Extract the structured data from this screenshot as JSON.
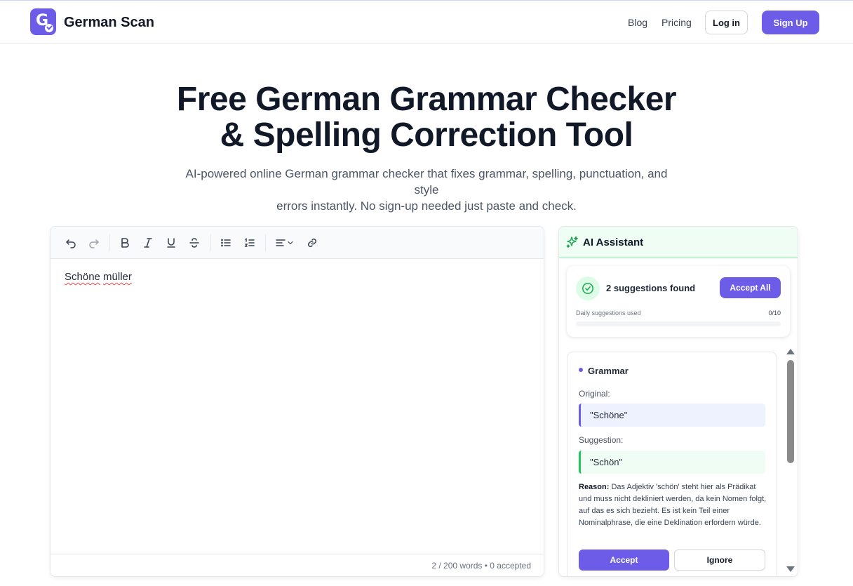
{
  "brand": {
    "name": "German Scan"
  },
  "nav": {
    "blog": "Blog",
    "pricing": "Pricing",
    "login": "Log in",
    "signup": "Sign Up"
  },
  "hero": {
    "title_line1": "Free German Grammar Checker",
    "title_line2": "& Spelling Correction Tool",
    "subtitle_line1": "AI-powered online German grammar checker that fixes grammar, spelling, punctuation, and style",
    "subtitle_line2": "errors instantly. No sign-up needed just paste and check."
  },
  "editor": {
    "toolbar": [
      "undo-icon",
      "redo-icon",
      "bold-icon",
      "italic-icon",
      "underline-icon",
      "strikethrough-icon",
      "bullet-list-icon",
      "numbered-list-icon",
      "align-icon",
      "link-icon"
    ],
    "word1": "Schöne",
    "word2": "müller",
    "footer": "2 / 200 words • 0 accepted"
  },
  "assistant": {
    "title": "AI Assistant",
    "summary": "2 suggestions found",
    "accept_all": "Accept All",
    "usage_label": "Daily suggestions used",
    "usage_count": "0/10",
    "usage_used": 0,
    "usage_limit": 10,
    "card": {
      "category": "Grammar",
      "original_label": "Original:",
      "original": "\"Schöne\"",
      "suggestion_label": "Suggestion:",
      "suggestion": "\"Schön\"",
      "reason_label": "Reason:",
      "reason": "Das Adjektiv 'schön' steht hier als Prädikat und muss nicht dekliniert werden, da kein Nomen folgt, auf das es sich bezieht. Es ist kein Teil einer Nominalphrase, die eine Deklination erfordern würde.",
      "accept": "Accept",
      "ignore": "Ignore"
    }
  },
  "colors": {
    "accent": "#6c5ce7",
    "success": "#22c55e",
    "error": "#ef4444"
  }
}
